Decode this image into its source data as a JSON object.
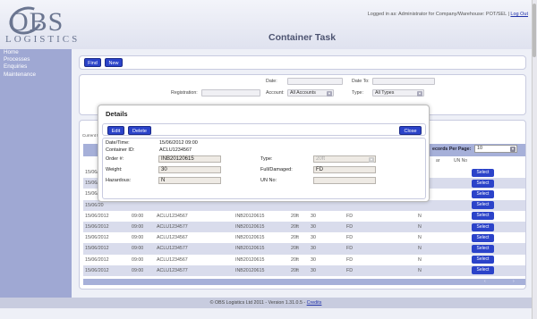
{
  "header": {
    "logo_main": "OBS",
    "logo_sub": "LOGISTICS",
    "login_text": "Logged in as: Administrator for Company/Warehouse: POT/SEL |",
    "logout_label": "Log Out",
    "title": "Container Task"
  },
  "sidebar": {
    "items": [
      {
        "label": "Home"
      },
      {
        "label": "Processes"
      },
      {
        "label": "Enquiries"
      },
      {
        "label": "Maintenance"
      }
    ]
  },
  "toolbar": {
    "find_label": "Find",
    "new_label": "New"
  },
  "filters": {
    "date_label": "Date:",
    "date_to_label": "Date To:",
    "registration_label": "Registration:",
    "account_label": "Account:",
    "account_value": "All Accounts",
    "type_label": "Type:",
    "type_value": "All Types",
    "date_value": "",
    "date_to_value": "",
    "registration_value": ""
  },
  "results": {
    "label": "Current t",
    "records_per_page_label": "ecords Per Page:",
    "records_per_page_value": "10",
    "col_ar": "ar",
    "col_un_no": "UN No",
    "select_label": "Select",
    "pager_prev": "‹",
    "pager_next": "›",
    "rows": [
      {
        "date": "15/06/20",
        "time": "",
        "container": "",
        "order": "",
        "type": "",
        "weight": "",
        "status": "",
        "hazardous": "",
        "un": ""
      },
      {
        "date": "15/06/20",
        "time": "",
        "container": "",
        "order": "",
        "type": "",
        "weight": "",
        "status": "",
        "hazardous": "",
        "un": ""
      },
      {
        "date": "15/06/20",
        "time": "",
        "container": "",
        "order": "",
        "type": "",
        "weight": "",
        "status": "",
        "hazardous": "",
        "un": ""
      },
      {
        "date": "15/06/20",
        "time": "",
        "container": "",
        "order": "",
        "type": "",
        "weight": "",
        "status": "",
        "hazardous": "",
        "un": ""
      },
      {
        "date": "15/06/2012",
        "time": "09:00",
        "container": "ACLU1234567",
        "order": "INB20120615",
        "type": "20ft",
        "weight": "30",
        "status": "FD",
        "hazardous": "N",
        "un": ""
      },
      {
        "date": "15/06/2012",
        "time": "09:00",
        "container": "ACLU1234577",
        "order": "INB20120615",
        "type": "20ft",
        "weight": "30",
        "status": "FD",
        "hazardous": "N",
        "un": ""
      },
      {
        "date": "15/06/2012",
        "time": "09:00",
        "container": "ACLU1234567",
        "order": "INB20120615",
        "type": "20ft",
        "weight": "30",
        "status": "FD",
        "hazardous": "N",
        "un": ""
      },
      {
        "date": "15/06/2012",
        "time": "09:00",
        "container": "ACLU1234577",
        "order": "INB20120615",
        "type": "20ft",
        "weight": "30",
        "status": "FD",
        "hazardous": "N",
        "un": ""
      },
      {
        "date": "15/06/2012",
        "time": "09:00",
        "container": "ACLU1234567",
        "order": "INB20120615",
        "type": "20ft",
        "weight": "30",
        "status": "FD",
        "hazardous": "N",
        "un": ""
      },
      {
        "date": "15/06/2012",
        "time": "09:00",
        "container": "ACLU1234577",
        "order": "INB20120615",
        "type": "20ft",
        "weight": "30",
        "status": "FD",
        "hazardous": "N",
        "un": ""
      }
    ]
  },
  "modal": {
    "title": "Details",
    "edit_label": "Edit",
    "delete_label": "Delete",
    "close_label": "Close",
    "datetime_label": "Date/Time:",
    "datetime_value": "15/06/2012 09:00",
    "container_label": "Container ID:",
    "container_value": "ACLU1234567",
    "order_label": "Order #:",
    "order_value": "INB20120615",
    "type_label": "Type:",
    "type_value": "20ft",
    "weight_label": "Weight:",
    "weight_value": "30",
    "fulldamaged_label": "Full/Damaged:",
    "fulldamaged_value": "FD",
    "hazardous_label": "Hazardous:",
    "hazardous_value": "N",
    "unno_label": "UN No:",
    "unno_value": ""
  },
  "footer": {
    "text": "© OBS Logistics Ltd 2011 - Version 1.31.0.5 -",
    "credits_label": "Credits"
  },
  "colors": {
    "sidebar": "#9fa8d3",
    "button": "#2b43c9",
    "table_header": "#a6b0d9",
    "row_alt": "#d9dcec"
  }
}
